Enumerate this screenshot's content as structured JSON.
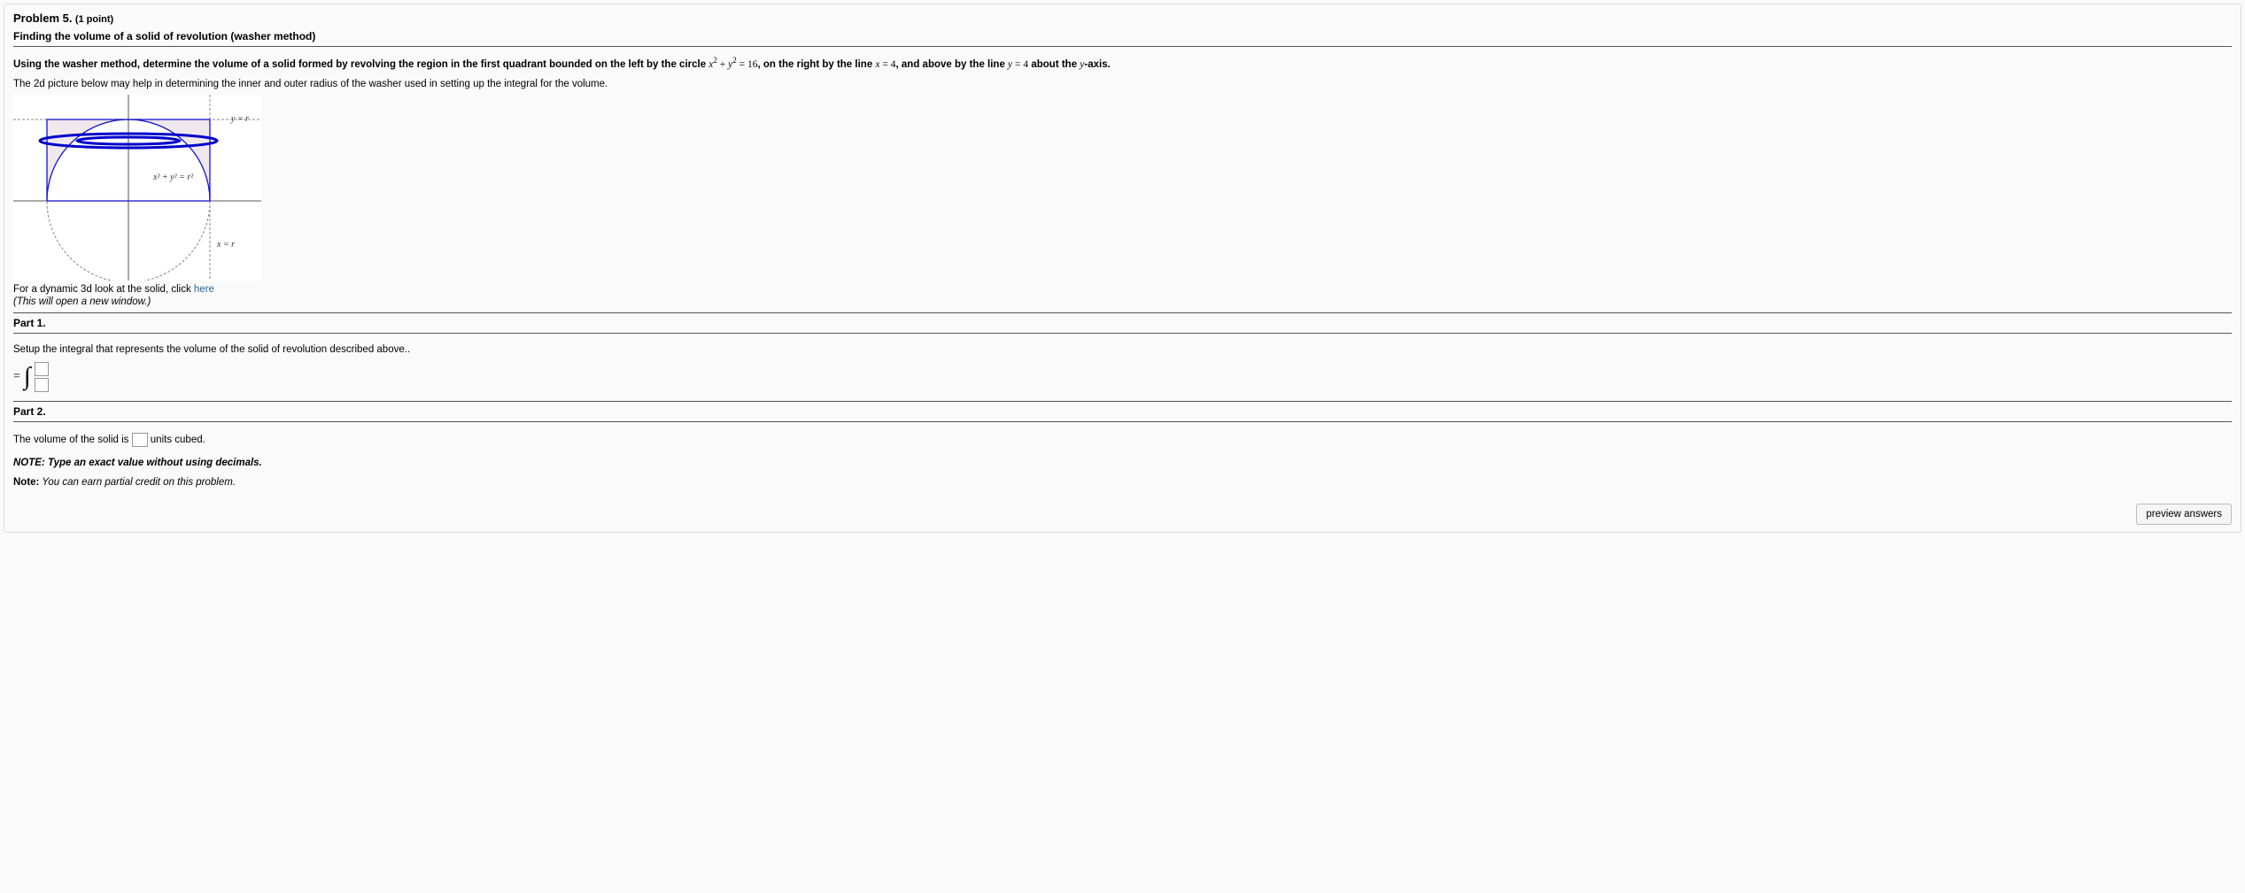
{
  "problem": {
    "title": "Problem 5.",
    "points": "(1 point)",
    "subtitle": "Finding the volume of a solid of revolution (washer method)",
    "instruction_pre": "Using the washer method, determine the volume of a solid formed by revolving the region in the first quadrant bounded on the left by the circle ",
    "eq_circle_lhs": "x² + y²",
    "eq_circle_rhs_pre": " = 16",
    "instr_mid1": ", on the right by the line ",
    "eq_x": "x = 4",
    "instr_mid2": ", and above by the line ",
    "eq_y": "y = 4",
    "instr_end_pre": " about the ",
    "axis": "y",
    "instr_end": "-axis.",
    "helper_text": "The 2d picture below may help in determining the inner and outer radius of the washer used in setting up the integral for the volume.",
    "fig_label_yr": "y = r",
    "fig_label_circle": "x² + y² = r²",
    "fig_label_xr": "x = r",
    "link_pre": "For a dynamic 3d look at the solid, click ",
    "link_text": "here",
    "link_note": "(This will open a new window.)",
    "part1": "Part 1.",
    "setup_text": "Setup the integral that represents the volume of the solid of revolution described above..",
    "part2": "Part 2.",
    "vol_pre": "The volume of the solid is ",
    "vol_post": " units cubed.",
    "note_exact": "NOTE: Type an exact value without using decimals.",
    "note_label": "Note:",
    "note_partial": " You can earn partial credit on this problem.",
    "preview_btn": "preview answers"
  }
}
